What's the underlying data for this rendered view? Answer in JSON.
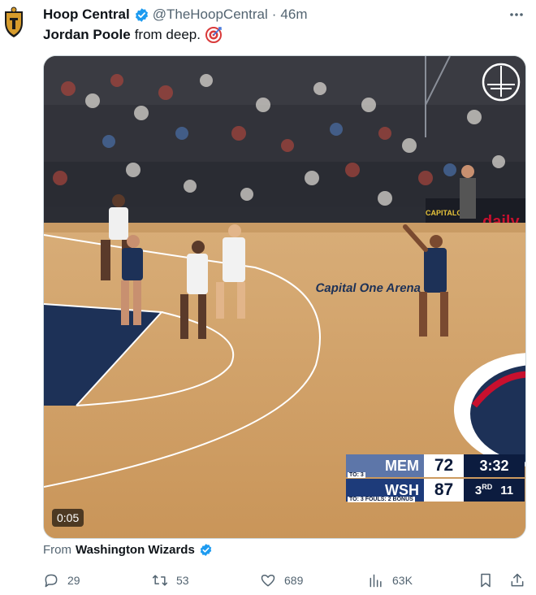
{
  "author": {
    "display_name": "Hoop Central",
    "handle": "@TheHoopCentral",
    "separator": "·",
    "time": "46m",
    "verified": true
  },
  "tweet": {
    "text_bold": "Jordan Poole",
    "text_rest": "from deep.",
    "emoji": "target-icon"
  },
  "media": {
    "duration": "0:05",
    "scorebug": {
      "team1": "MEM",
      "score1": "72",
      "clock": "3:32",
      "team2": "WSH",
      "score2": "87",
      "quarter": "3",
      "quarter_suffix": "RD",
      "shot_clock": "11",
      "to1": "TO: 3",
      "to2": "TO: 3  FOULS: 2  BONUS"
    },
    "court_signs": [
      "Capital One Arena",
      "CAPITALONE",
      "daily"
    ]
  },
  "source": {
    "prefix": "From",
    "name": "Washington Wizards"
  },
  "actions": {
    "replies": "29",
    "reposts": "53",
    "likes": "689",
    "views": "63K"
  },
  "colors": {
    "verified_blue": "#1d9bf0",
    "text_secondary": "#536471",
    "wizards_navy": "#0c1c3f",
    "wizards_red": "#c8102e"
  }
}
